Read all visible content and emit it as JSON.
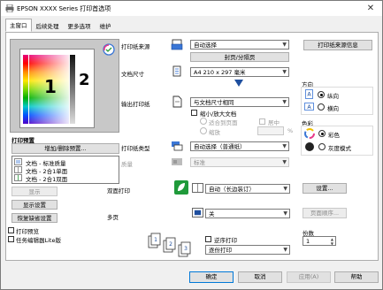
{
  "window": {
    "title": "EPSON XXXX Series 打印首选项",
    "close_glyph": "✕"
  },
  "tabs": [
    {
      "label": "主窗口"
    },
    {
      "label": "后续处理"
    },
    {
      "label": "更多选项"
    },
    {
      "label": "维护"
    }
  ],
  "preview": {
    "page_number_1": "1",
    "page_number_2": "2"
  },
  "left": {
    "presets_title": "打印预置",
    "add_remove_button": "增加/删除预置...",
    "presets": [
      {
        "label": "文档 - 标准质量"
      },
      {
        "label": "文档 - 2合1单面"
      },
      {
        "label": "文档 - 2合1双面"
      }
    ],
    "show_button": "显示",
    "show_settings_button": "显示设置",
    "restore_defaults_button": "恢复缺省设置",
    "print_preview_label": "打印预览",
    "job_arranger_label": "任务编辑器Lite版"
  },
  "paper_source": {
    "label": "打印纸来源",
    "value": "自动选择",
    "config_button": "封页/分隔页",
    "info_button": "打印纸来源信息"
  },
  "doc_size": {
    "label": "文档尺寸",
    "value": "A4 210 x 297 毫米"
  },
  "output_paper": {
    "label": "输出打印纸",
    "value": "与文档尺寸相同",
    "reduce_enlarge_label": "缩小/放大文档",
    "fit_page_label": "适合到页面",
    "center_label": "居中",
    "zoom_label": "缩放",
    "zoom_unit": "%"
  },
  "orientation": {
    "title": "方向",
    "portrait_label": "纵向",
    "landscape_label": "横向"
  },
  "paper_type": {
    "label": "打印纸类型",
    "value": "自动选择（普通纸）"
  },
  "quality": {
    "label": "质量",
    "value": "标准"
  },
  "color": {
    "title": "色彩",
    "color_label": "彩色",
    "grayscale_label": "灰度模式"
  },
  "duplex": {
    "label": "双面打印",
    "value": "自动（长边装订）",
    "settings_button": "设置..."
  },
  "multipage": {
    "label": "多页",
    "value": "关",
    "page_order_button": "页面顺序..."
  },
  "reverse_order": {
    "label": "逆序打印",
    "collate_value": "逐份打印"
  },
  "copies": {
    "label": "份数",
    "value": "1"
  },
  "footer": {
    "ok": "确定",
    "cancel": "取消",
    "apply": "应用(A)",
    "help": "帮助"
  }
}
